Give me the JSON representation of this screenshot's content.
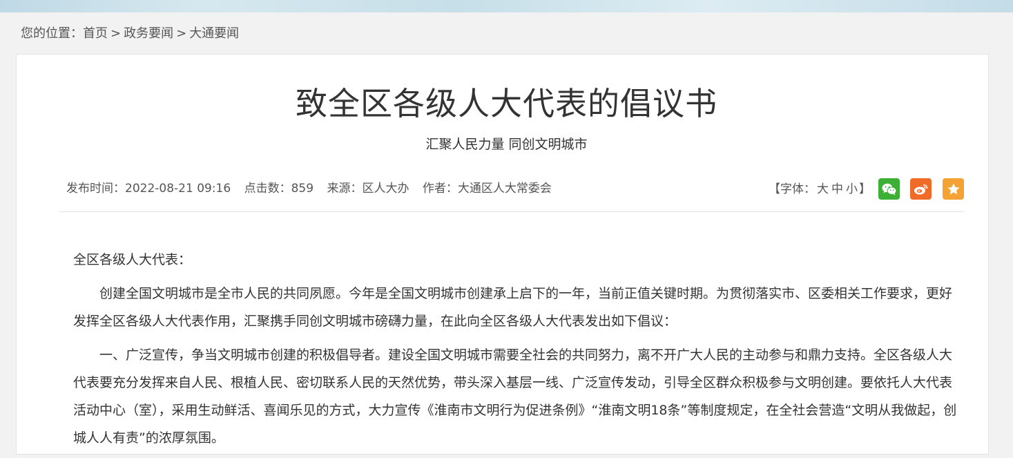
{
  "breadcrumb": {
    "prefix": "您的位置：",
    "items": [
      "首页",
      "政务要闻",
      "大通要闻"
    ],
    "separator": ">"
  },
  "article": {
    "title": "致全区各级人大代表的倡议书",
    "subtitle": "汇聚人民力量 同创文明城市",
    "meta": {
      "publish_time": "发布时间：2022-08-21 09:16",
      "views": "点击数：859",
      "source": "来源：区人大办",
      "author": "作者：大通区人大常委会"
    },
    "font_size": {
      "open": "【字体：",
      "large": "大",
      "medium": "中",
      "small": "小",
      "close": "】"
    },
    "paragraphs": [
      "全区各级人大代表：",
      "创建全国文明城市是全市人民的共同夙愿。今年是全国文明城市创建承上启下的一年，当前正值关键时期。为贯彻落实市、区委相关工作要求，更好发挥全区各级人大代表作用，汇聚携手同创文明城市磅礴力量，在此向全区各级人大代表发出如下倡议：",
      "一、广泛宣传，争当文明城市创建的积极倡导者。建设全国文明城市需要全社会的共同努力，离不开广大人民的主动参与和鼎力支持。全区各级人大代表要充分发挥来自人民、根植人民、密切联系人民的天然优势，带头深入基层一线、广泛宣传发动，引导全区群众积极参与文明创建。要依托人大代表活动中心（室），采用生动鲜活、喜闻乐见的方式，大力宣传《淮南市文明行为促进条例》“淮南文明18条”等制度规定，在全社会营造“文明从我做起，创城人人有责”的浓厚氛围。"
    ]
  },
  "icons": {
    "wechat": "wechat-icon",
    "weibo": "weibo-icon",
    "favorite": "star-icon"
  },
  "colors": {
    "wechat": "#3cb034",
    "weibo": "#f06a28",
    "favorite": "#f5a234"
  }
}
